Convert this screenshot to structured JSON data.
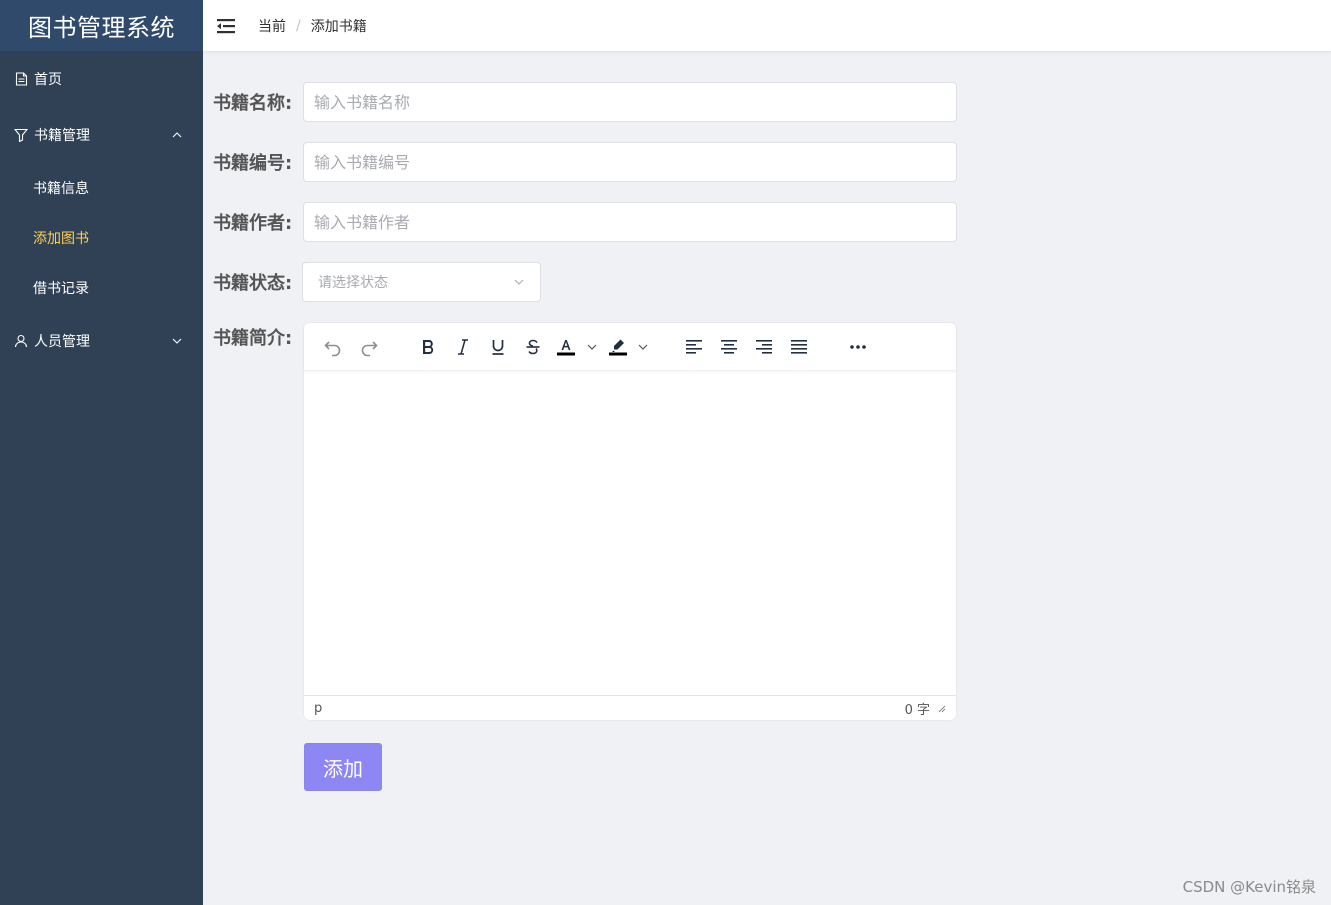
{
  "app": {
    "title": "图书管理系统"
  },
  "sidebar": {
    "items": [
      {
        "label": "首页",
        "icon": "document-icon"
      },
      {
        "label": "书籍管理",
        "icon": "filter-icon",
        "expanded": true,
        "children": [
          {
            "label": "书籍信息",
            "active": false
          },
          {
            "label": "添加图书",
            "active": true
          },
          {
            "label": "借书记录",
            "active": false
          }
        ]
      },
      {
        "label": "人员管理",
        "icon": "user-icon",
        "expanded": false
      }
    ],
    "colors": {
      "background": "#304156",
      "active_text": "#ffd04b"
    }
  },
  "header": {
    "breadcrumb": [
      "当前",
      "添加书籍"
    ],
    "separator": "/"
  },
  "form": {
    "name": {
      "label": "书籍名称:",
      "placeholder": "输入书籍名称",
      "value": ""
    },
    "code": {
      "label": "书籍编号:",
      "placeholder": "输入书籍编号",
      "value": ""
    },
    "author": {
      "label": "书籍作者:",
      "placeholder": "输入书籍作者",
      "value": ""
    },
    "status": {
      "label": "书籍状态:",
      "placeholder": "请选择状态",
      "value": ""
    },
    "intro": {
      "label": "书籍简介:"
    },
    "submit_label": "添加"
  },
  "editor": {
    "toolbar": [
      "undo-icon",
      "redo-icon",
      "bold-icon",
      "italic-icon",
      "underline-icon",
      "strikethrough-icon",
      "text-color-icon",
      "highlight-icon",
      "align-left-icon",
      "align-center-icon",
      "align-right-icon",
      "align-justify-icon",
      "more-icon"
    ],
    "status_path": "p",
    "word_count": "0 字"
  },
  "watermark": "CSDN @Kevin铭泉"
}
